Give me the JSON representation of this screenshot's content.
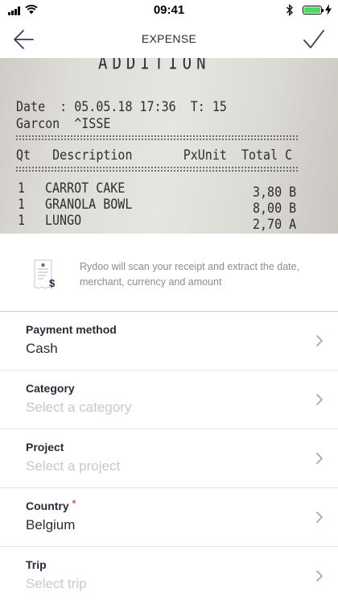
{
  "status": {
    "time": "09:41"
  },
  "nav": {
    "title": "EXPENSE"
  },
  "receipt": {
    "header": "ADDITION",
    "date_line": "Date  : 05.05.18 17:36  T: 15",
    "garcon_line": "Garcon  ^ISSE",
    "columns_line": "Qt   Description       PxUnit  Total C",
    "items": [
      {
        "qty": "1",
        "desc": "CARROT CAKE",
        "total": "3,80 B"
      },
      {
        "qty": "1",
        "desc": "GRANOLA BOWL",
        "total": "8,00 B"
      },
      {
        "qty": "1",
        "desc": "LUNGO",
        "total": "2,70 A"
      }
    ]
  },
  "scan_info": {
    "text": "Rydoo will scan your receipt and extract the date, merchant, currency and amount"
  },
  "fields": [
    {
      "label": "Payment method",
      "value": "Cash",
      "placeholder": false,
      "required": false
    },
    {
      "label": "Category",
      "value": "Select a category",
      "placeholder": true,
      "required": false
    },
    {
      "label": "Project",
      "value": "Select a project",
      "placeholder": true,
      "required": false
    },
    {
      "label": "Country",
      "value": "Belgium",
      "placeholder": false,
      "required": true
    },
    {
      "label": "Trip",
      "value": "Select trip",
      "placeholder": true,
      "required": false
    }
  ],
  "colors": {
    "required": "#e8445a",
    "placeholder": "#c8c6d2",
    "battery": "#4cd964"
  },
  "icons": [
    "signal-icon",
    "wifi-icon",
    "bluetooth-icon",
    "battery-icon",
    "back-arrow-icon",
    "checkmark-icon",
    "receipt-icon",
    "chevron-right-icon"
  ]
}
